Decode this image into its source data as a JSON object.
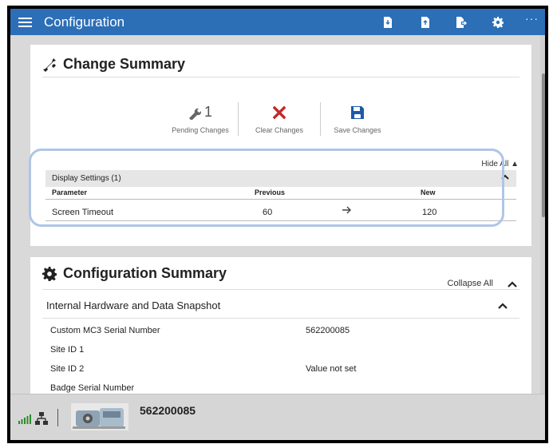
{
  "topbar": {
    "title": "Configuration",
    "icons": [
      "download-file-icon",
      "upload-file-icon",
      "export-file-icon",
      "gear-icon"
    ],
    "more": "···"
  },
  "change_summary": {
    "title": "Change Summary",
    "pending_count": "1",
    "pending_label": "Pending Changes",
    "clear_label": "Clear Changes",
    "save_label": "Save Changes",
    "hide_all": "Hide All",
    "group": {
      "title": "Display Settings (1)",
      "columns": {
        "parameter": "Parameter",
        "previous": "Previous",
        "new": "New"
      },
      "rows": [
        {
          "parameter": "Screen Timeout",
          "previous": "60",
          "new": "120"
        }
      ]
    }
  },
  "config_summary": {
    "title": "Configuration Summary",
    "collapse_all": "Collapse All",
    "section_title": "Internal Hardware and Data Snapshot",
    "items": [
      {
        "label": "Custom MC3 Serial Number",
        "value": "562200085"
      },
      {
        "label": "Site ID 1",
        "value": ""
      },
      {
        "label": "Site ID 2",
        "value": "Value not set"
      },
      {
        "label": "Badge Serial Number",
        "value": ""
      }
    ]
  },
  "bottombar": {
    "serial": "562200085"
  },
  "colors": {
    "accent": "#2c6fb7",
    "clear_red": "#c62828",
    "save_blue": "#1e5aa8",
    "highlight": "#aec6e6"
  }
}
